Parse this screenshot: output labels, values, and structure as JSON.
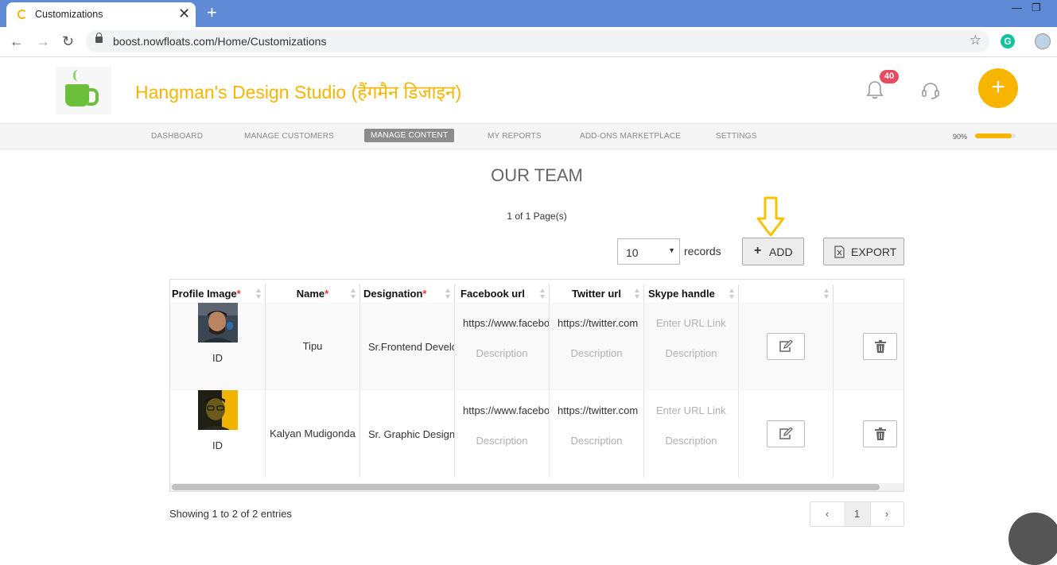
{
  "browser": {
    "tab_title": "Customizations",
    "url": "boost.nowfloats.com/Home/Customizations",
    "ext_letter": "G"
  },
  "header": {
    "brand": "Hangman's Design Studio (हैंगमैन डिजाइन)",
    "notifications": "40",
    "fab_label": "+"
  },
  "nav": {
    "items": [
      "DASHBOARD",
      "MANAGE CUSTOMERS",
      "MANAGE CONTENT",
      "MY REPORTS",
      "ADD-ONS MARKETPLACE",
      "SETTINGS"
    ],
    "active": "MANAGE CONTENT",
    "progress_label": "90%",
    "progress_value": 0.9
  },
  "content": {
    "title": "OUR TEAM",
    "page_info": "1 of 1 Page(s)",
    "records_value": "10",
    "records_label": "records",
    "add_label": "ADD",
    "export_label": "EXPORT",
    "showing": "Showing 1 to 2 of 2 entries",
    "page_number": "1"
  },
  "table": {
    "headers": [
      "Profile Image",
      "Name",
      "Designation",
      "Facebook url",
      "Twitter url",
      "Skype handle",
      "",
      ""
    ],
    "rows": [
      {
        "id": "ID",
        "name": "Tipu",
        "designation": "Sr.Frontend Developer",
        "facebook": "https://www.facebook.com",
        "twitter": "https://twitter.com",
        "skype_placeholder": "Enter URL Link",
        "description": "Description"
      },
      {
        "id": "ID",
        "name": "Kalyan Mudigonda",
        "designation": "Sr. Graphic Designer",
        "facebook": "https://www.facebook.com",
        "twitter": "https://twitter.com",
        "skype_placeholder": "Enter URL Link",
        "description": "Description"
      }
    ]
  },
  "colors": {
    "accent": "#f7b500",
    "badge": "#e84a5f",
    "chrome": "#5f8ad6"
  }
}
